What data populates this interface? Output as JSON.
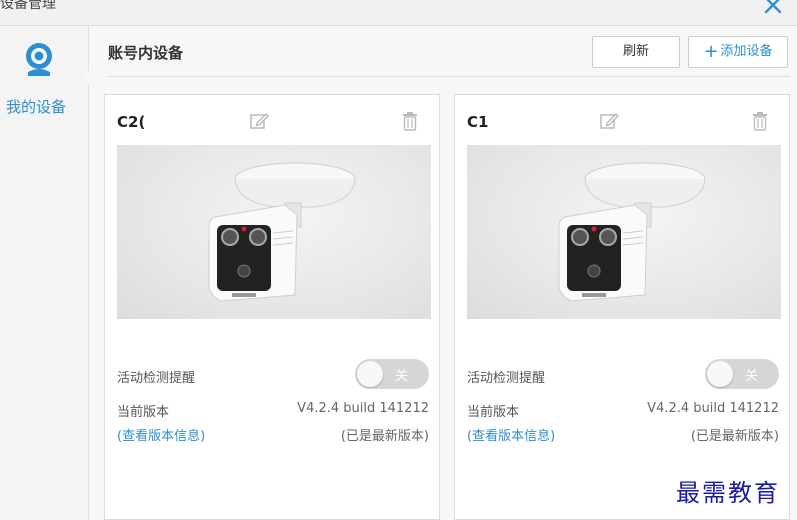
{
  "window": {
    "title": "设备管理",
    "close_icon": "close-icon"
  },
  "sidebar": {
    "items": [
      {
        "label": "我的设备",
        "icon": "webcam-icon",
        "active": true
      }
    ]
  },
  "header": {
    "title": "账号内设备",
    "refresh_label": "刷新",
    "add_label": "添加设备",
    "add_icon": "+"
  },
  "devices": [
    {
      "name": "C2(",
      "motion_label": "活动检测提醒",
      "motion_state": "关",
      "version_label": "当前版本",
      "version_value": "V4.2.4 build 141212",
      "version_link": "(查看版本信息)",
      "version_status": "(已是最新版本)"
    },
    {
      "name": "C1",
      "motion_label": "活动检测提醒",
      "motion_state": "关",
      "version_label": "当前版本",
      "version_value": "V4.2.4 build 141212",
      "version_link": "(查看版本信息)",
      "version_status": "(已是最新版本)"
    }
  ],
  "watermark": "最需教育",
  "colors": {
    "accent": "#2c8fd1",
    "toggle_off": "#d6d6d6",
    "watermark": "#1a1aa6"
  }
}
